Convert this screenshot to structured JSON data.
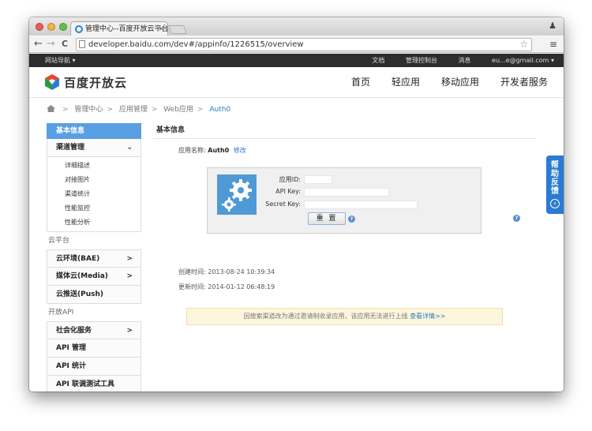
{
  "browser": {
    "tab_title": "管理中心--百度开放云平台",
    "tab_close": "×",
    "url": "developer.baidu.com/dev#/appinfo/1226515/overview",
    "back": "←",
    "forward": "→",
    "reload": "C"
  },
  "topstrip": {
    "site_nav": "网站导航 ▾",
    "links": [
      "文档",
      "管理控制台",
      "消息",
      "eu...e@gmail.com ▾"
    ]
  },
  "header": {
    "logo_text": "百度开放云",
    "nav": [
      "首页",
      "轻应用",
      "移动应用",
      "开发者服务"
    ]
  },
  "breadcrumb": {
    "items": [
      "管理中心",
      "应用管理",
      "Web应用"
    ],
    "current": "Auth0",
    "sep": ">"
  },
  "sidebar": {
    "active": "基本信息",
    "channel": "渠道管理",
    "channel_sub": [
      "详细描述",
      "对接图片",
      "渠道统计",
      "性能监控",
      "性能分析"
    ],
    "group_cloud": "云平台",
    "cloud_items": [
      "云环境(BAE)",
      "媒体云(Media)",
      "云推送(Push)"
    ],
    "group_api": "开放API",
    "api_items": [
      "社会化服务",
      "API 管理",
      "API 统计",
      "API 联调测试工具"
    ]
  },
  "content": {
    "title": "基本信息",
    "app_name_label": "应用名称:",
    "app_name": "Auth0",
    "edit_label": "修改",
    "keys": {
      "id_label": "应用ID:",
      "apikey_label": "API Key:",
      "secret_label": "Secret Key:",
      "reset_label": "重 置"
    },
    "created_label": "创建时间:",
    "created": "2013-08-24 10:39:34",
    "updated_label": "更新时间:",
    "updated": "2014-01-12 06:48:19",
    "notice_text": "因搜索渠道改为通过邀请制收录应用，该应用无法进行上线",
    "notice_link": "查看详情>>"
  },
  "feedback": {
    "label": [
      "帮",
      "助",
      "反",
      "馈"
    ]
  },
  "colors": {
    "accent": "#5a9fe4",
    "link": "#2a7ac7",
    "dark_strip": "#2d2d2d",
    "feedback": "#2b7bd3"
  }
}
